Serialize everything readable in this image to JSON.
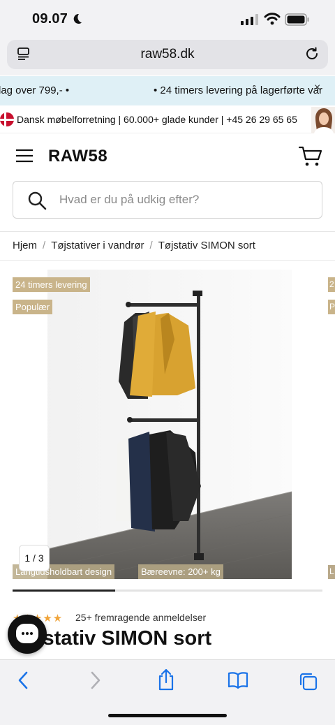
{
  "status": {
    "time": "09.07"
  },
  "browser": {
    "url": "raw58.dk"
  },
  "marquee": {
    "left_text": "lag over 799,- •",
    "right_text": "• 24 timers levering på lagerførte var",
    "close_symbol": "×"
  },
  "infobar": {
    "text": "Dansk møbelforretning | 60.000+ glade kunder | +45 26 29 65 65"
  },
  "header": {
    "logo": "RAW58"
  },
  "search": {
    "placeholder": "Hvad er du på udkig efter?"
  },
  "breadcrumb": {
    "items": [
      "Hjem",
      "Tøjstativer i vandrør",
      "Tøjstativ SIMON sort"
    ],
    "separator": "/"
  },
  "gallery": {
    "badges_top": [
      "24 timers levering",
      "Populær"
    ],
    "badges_bottom": [
      "Langtidsholdbart design",
      "Bæreevne: 200+ kg"
    ],
    "peek_badges": [
      "2",
      "P",
      "L"
    ],
    "counter": "1 / 3",
    "progress_fraction": 0.33
  },
  "rating": {
    "stars": "★★★★★",
    "reviews": "25+ fremragende anmeldelser"
  },
  "product": {
    "title": "Tøjstativ SIMON sort"
  },
  "colors": {
    "badge": "#c9b48a",
    "marquee_bg": "#dff0f6",
    "star": "#f0a43a"
  },
  "icons": [
    "moon-icon",
    "signal-icon",
    "wifi-icon",
    "battery-icon",
    "reader-icon",
    "reload-icon",
    "menu-icon",
    "cart-icon",
    "search-icon",
    "chat-icon",
    "back-icon",
    "forward-icon",
    "share-icon",
    "bookmarks-icon",
    "tabs-icon"
  ]
}
